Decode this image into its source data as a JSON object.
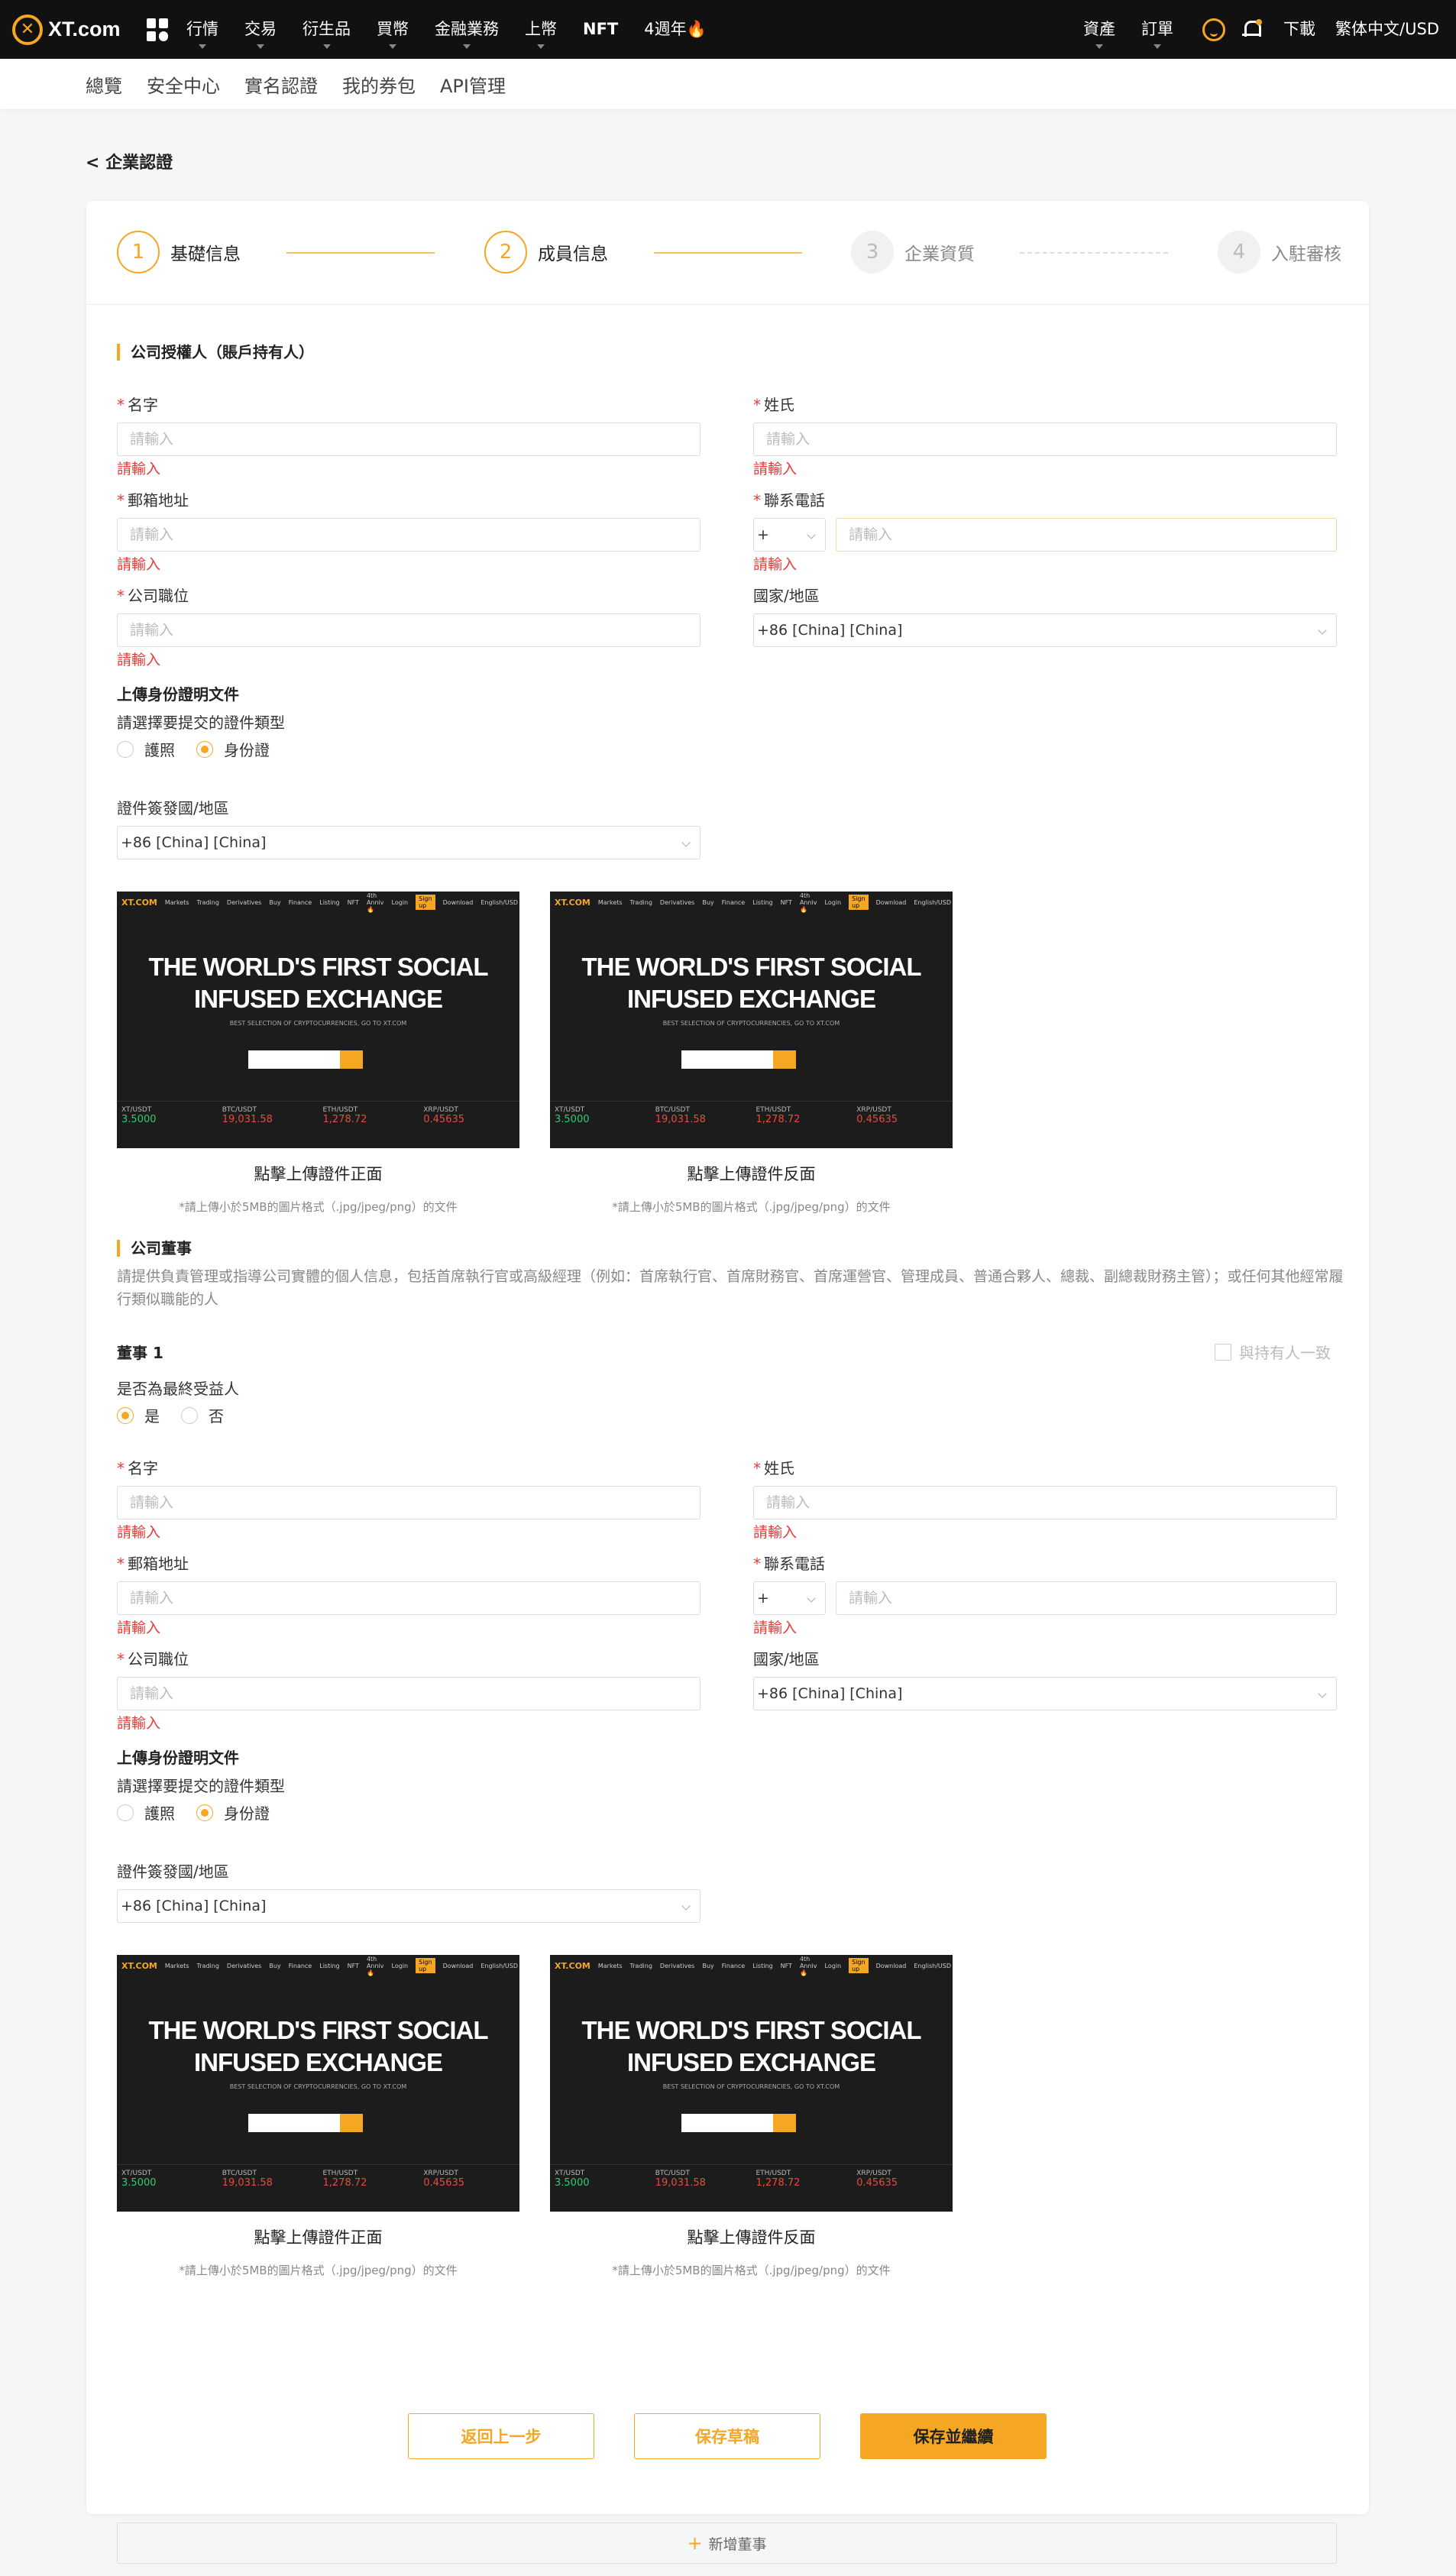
{
  "nav": {
    "logo_text": "XT.com",
    "items": [
      "行情",
      "交易",
      "衍生品",
      "買幣",
      "金融業務",
      "上幣",
      "NFT",
      "4週年🔥"
    ],
    "right": {
      "assets": "資產",
      "orders": "訂單",
      "download": "下載",
      "lang": "繁体中文/USD"
    }
  },
  "subnav": [
    "總覽",
    "安全中心",
    "實名認證",
    "我的券包",
    "API管理"
  ],
  "back_label": "< 企業認證",
  "steps": [
    {
      "num": "1",
      "label": "基礎信息"
    },
    {
      "num": "2",
      "label": "成員信息"
    },
    {
      "num": "3",
      "label": "企業資質"
    },
    {
      "num": "4",
      "label": "入駐審核"
    }
  ],
  "owner": {
    "title": "公司授權人（賬戶持有人）",
    "first_name": "名字",
    "last_name": "姓氏",
    "address": "郵箱地址",
    "phone": "聯系電話",
    "position": "公司職位",
    "country": "國家/地區"
  },
  "form": {
    "placeholder": "請輸入",
    "error": "請輸入",
    "phone_prefix": "+",
    "country_value": "+86 [China] [China]"
  },
  "id_upload": {
    "title": "上傳身份證明文件",
    "type_prompt": "請選擇要提交的證件類型",
    "passport": "護照",
    "id_card": "身份證",
    "issuer_label": "證件簽發國/地區",
    "issuer_value": "+86 [China] [China]",
    "front_label": "點擊上傳證件正面",
    "back_label": "點擊上傳證件反面",
    "hint": "*請上傳小於5MB的圖片格式（.jpg/jpeg/png）的文件"
  },
  "sample": {
    "logo": "XT.COM",
    "nav": [
      "Markets",
      "Trading",
      "Derivatives",
      "Buy",
      "Finance",
      "Listing",
      "NFT",
      "4th Anniv🔥"
    ],
    "login": "Login",
    "signup": "Sign up",
    "download": "Download",
    "lang": "English/USD",
    "headline_1": "THE WORLD'S FIRST SOCIAL",
    "headline_2": "INFUSED EXCHANGE",
    "sub": "BEST SELECTION OF CRYPTOCURRENCIES, GO TO XT.COM",
    "tickers": [
      {
        "pair": "XT/USDT",
        "price": "3.5000",
        "cls": "g"
      },
      {
        "pair": "BTC/USDT",
        "price": "19,031.58",
        "cls": "r"
      },
      {
        "pair": "ETH/USDT",
        "price": "1,278.72",
        "cls": "r"
      },
      {
        "pair": "XRP/USDT",
        "price": "0.45635",
        "cls": "r"
      }
    ]
  },
  "directors": {
    "title": "公司董事",
    "desc": "請提供負責管理或指導公司實體的個人信息，包括首席執行官或高級經理（例如：首席執行官、首席財務官、首席運營官、管理成員、普通合夥人、總裁、副總裁財務主管）；或任何其他經常履行類似職能的人",
    "director_1": "董事 1",
    "same_as_owner": "與持有人一致",
    "ubo_prompt": "是否為最終受益人",
    "yes": "是",
    "no": "否",
    "add": "新增董事"
  },
  "buttons": {
    "back": "返回上一步",
    "draft": "保存草稿",
    "continue": "保存並繼續"
  }
}
